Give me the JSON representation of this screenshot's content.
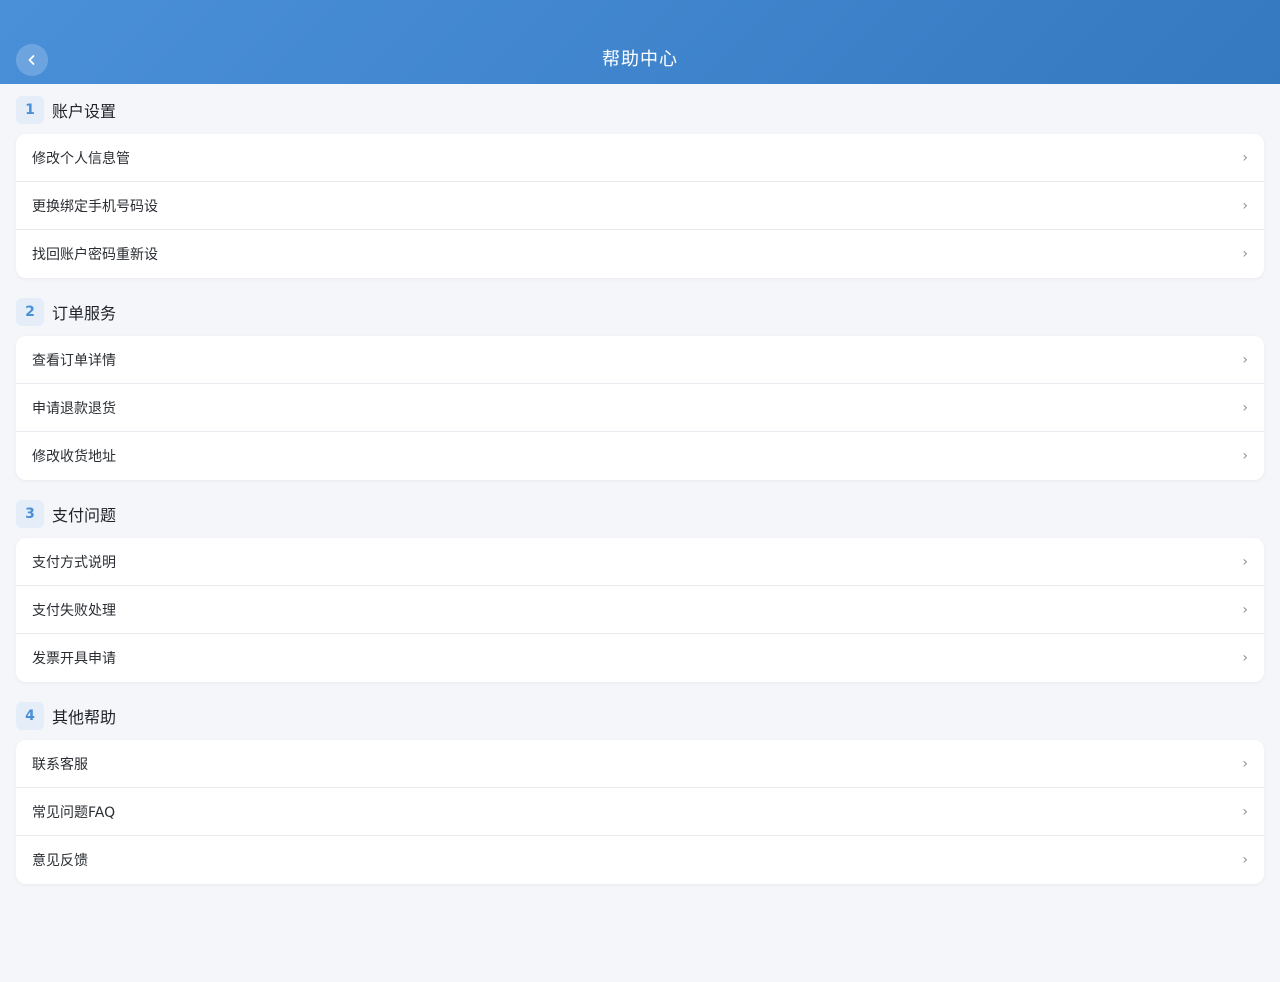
{
  "header": {
    "title": "帮助中心"
  },
  "sections": [
    {
      "num": "1",
      "title": "账户设置",
      "items": [
        "修改个人信息管",
        "更换绑定手机号码设",
        "找回账户密码重新设"
      ]
    },
    {
      "num": "2",
      "title": "订单服务",
      "items": [
        "查看订单详情",
        "申请退款退货",
        "修改收货地址"
      ]
    },
    {
      "num": "3",
      "title": "支付问题",
      "items": [
        "支付方式说明",
        "支付失败处理",
        "发票开具申请"
      ]
    },
    {
      "num": "4",
      "title": "其他帮助",
      "items": [
        "联系客服",
        "常见问题FAQ",
        "意见反馈"
      ]
    }
  ],
  "icons": {
    "back": "chevron-left-icon",
    "row": "chevron-right-icon"
  },
  "colors": {
    "header_start": "#4a90d9",
    "header_end": "#3579c0",
    "accent": "#4a90d9",
    "background": "#f4f6fa"
  }
}
